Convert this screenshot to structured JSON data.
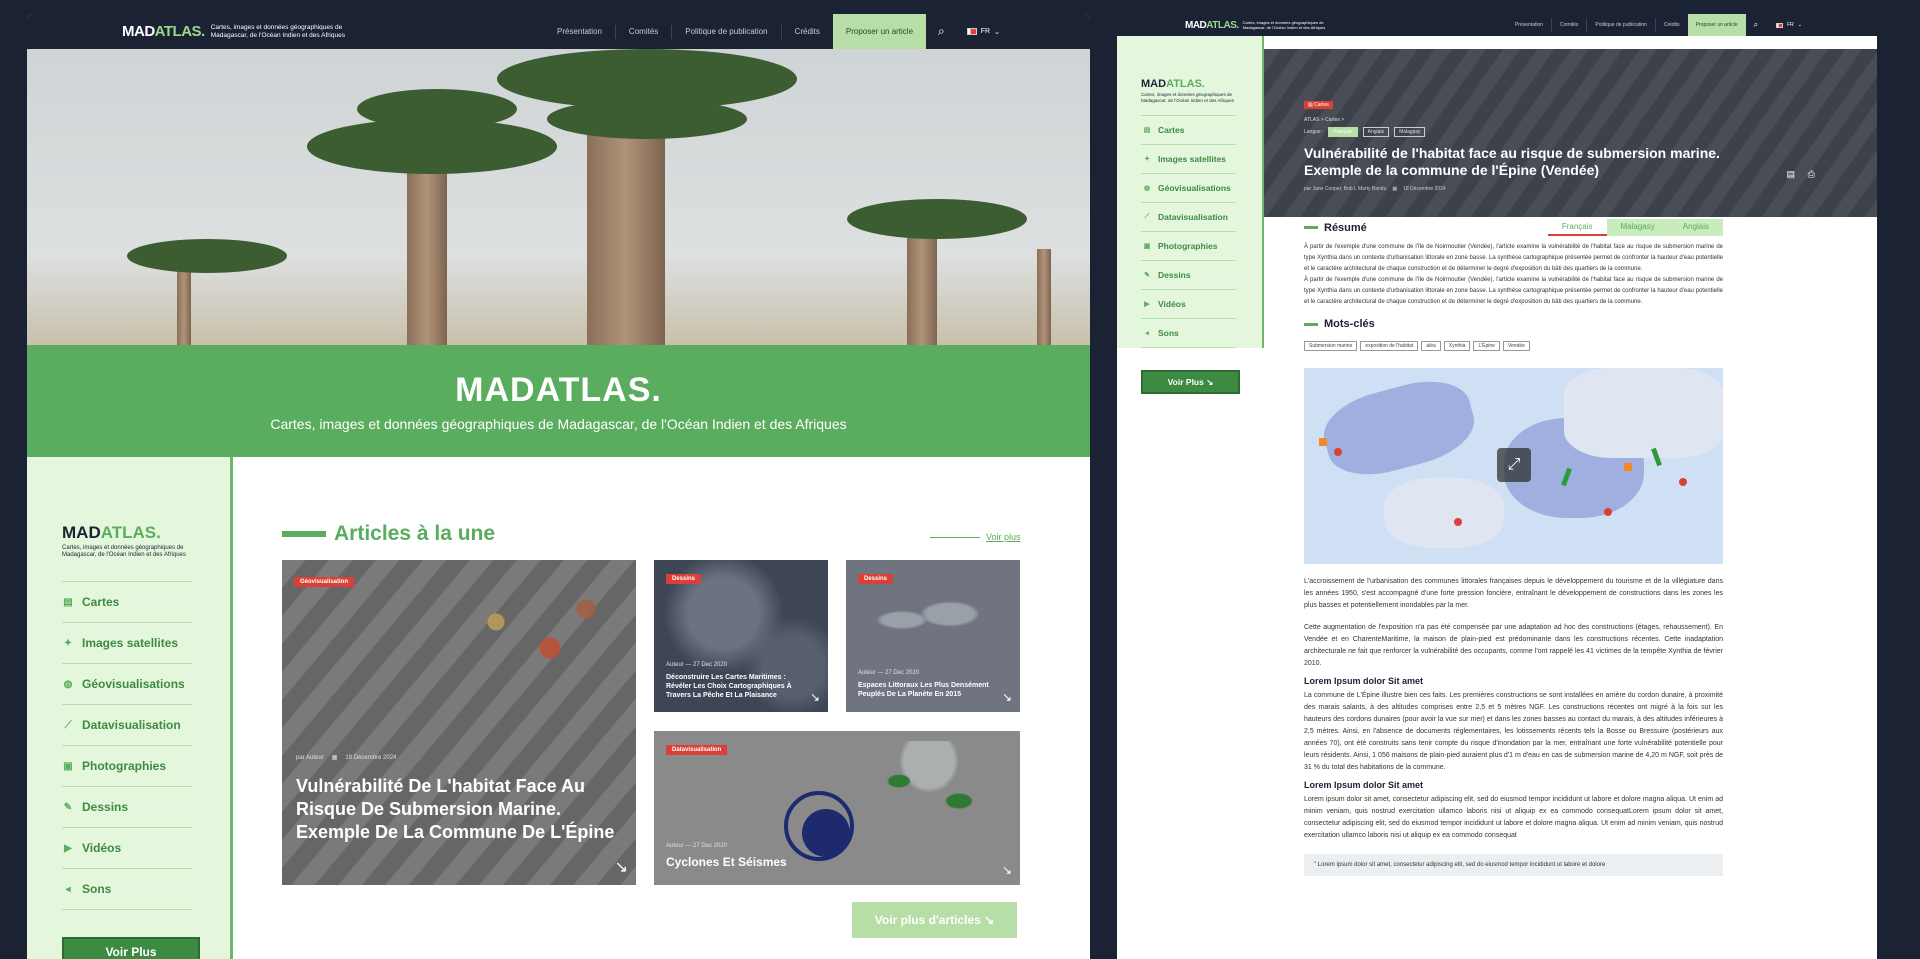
{
  "colors": {
    "brand": "#5aad5e",
    "nav": "#1a2233",
    "accent_red": "#d94038",
    "cta": "#b6dea6"
  },
  "brand": {
    "logo_a": "MAD",
    "logo_b": "ATLAS.",
    "tagline": "Cartes, images et données géographiques de Madagascar, de l'Océan Indien et des Afriques"
  },
  "nav": {
    "items": [
      "Présentation",
      "Comités",
      "Politique de publication",
      "Crédits"
    ],
    "cta": "Proposer un article",
    "search_icon": "search-icon",
    "lang": "FR"
  },
  "hero": {
    "title": "MADATLAS.",
    "subtitle": "Cartes, images et données géographiques de Madagascar, de l'Océan Indien et des Afriques"
  },
  "sidebar": {
    "items": [
      {
        "label": "Cartes",
        "icon": "map-icon"
      },
      {
        "label": "Images satellites",
        "icon": "satellite-icon"
      },
      {
        "label": "Géovisualisations",
        "icon": "globe-icon"
      },
      {
        "label": "Datavisualisation",
        "icon": "chart-icon"
      },
      {
        "label": "Photographies",
        "icon": "camera-icon"
      },
      {
        "label": "Dessins",
        "icon": "pencil-icon"
      },
      {
        "label": "Vidéos",
        "icon": "video-icon"
      },
      {
        "label": "Sons",
        "icon": "sound-icon"
      }
    ],
    "button": "Voir Plus"
  },
  "articles": {
    "title": "Articles à la une",
    "see_more": "Voir plus",
    "more_button": "Voir plus d'articles",
    "main": {
      "tag": "Géovisualisation",
      "author": "par Auteur",
      "date": "18 Décembre 2024",
      "title": "Vulnérabilité De L'habitat Face Au Risque De Submersion Marine. Exemple De La Commune De L'Épine"
    },
    "c1": {
      "tag": "Dessins",
      "meta": "Auteur — 27 Dec 2020",
      "title": "Déconstruire Les Cartes Maritimes : Révéler Les Choix Cartographiques À Travers La Pêche Et La Plaisance"
    },
    "c2": {
      "tag": "Dessins",
      "meta": "Auteur — 27 Dec 2020",
      "title": "Espaces Littoraux Les Plus Densément Peuplés De La Planète En 2015"
    },
    "c3": {
      "tag": "Datavisualisation",
      "meta": "Auteur — 27 Dec 2020",
      "title": "Cyclones Et Séismes"
    }
  },
  "detail": {
    "tag": "Cartes",
    "breadcrumb": "ATLAS > Cartes >",
    "lang_label": "Langue :",
    "langs": [
      "Français",
      "Anglais",
      "Malagasy"
    ],
    "title": "Vulnérabilité de l'habitat face au risque de submersion marine. Exemple de la commune de l'Épine (Vendée)",
    "byline": "par Jane Cooper, Bob L Marty Bandu",
    "date": "18 Décembre 2024",
    "resume_title": "Résumé",
    "tabs": [
      "Français",
      "Malagasy",
      "Anglais"
    ],
    "resume_p1": "À partir de l'exemple d'une commune de l'île de Noirmoutier (Vendée), l'article examine la vulnérabilité de l'habitat face au risque de submersion marine de type Xynthia dans un contexte d'urbanisation littorale en zone basse. La synthèse cartographique présentée permet de confronter la hauteur d'eau potentielle et le caractère architectural de chaque construction et de déterminer le degré d'exposition du bâti des quartiers de la commune.",
    "resume_p2": "À partir de l'exemple d'une commune de l'île de Noirmoutier (Vendée), l'article examine la vulnérabilité de l'habitat face au risque de submersion marine de type Xynthia dans un contexte d'urbanisation littorale en zone basse. La synthèse cartographique présentée permet de confronter la hauteur d'eau potentielle et le caractère architectural de chaque construction et de déterminer le degré d'exposition du bâti des quartiers de la commune.",
    "kw_title": "Mots-clés",
    "keywords": [
      "Submersion marine",
      "exposition de l'habitat",
      "aléa",
      "Xynthia",
      "L'Épine",
      "Vendée"
    ],
    "body1": "L'accroissement de l'urbanisation des communes littorales françaises depuis le développement du tourisme et de la villégiature dans les années 1950, s'est accompagné d'une forte pression foncière, entraînant le développement de constructions dans les zones les plus basses et potentiellement inondables par la mer.",
    "body2": "Cette augmentation de l'exposition n'a pas été compensée par une adaptation ad hoc des constructions (étages, rehaussement). En Vendée et en CharenteMaritime, la maison de plain-pied est prédominante dans les constructions récentes. Cette inadaptation architecturale ne fait que renforcer la vulnérabilité des occupants, comme l'ont rappelé les 41 victimes de la tempête Xynthia de février 2010.",
    "h1": "Lorem Ipsum dolor Sit amet",
    "body3": "La commune de L'Épine illustre bien ces faits. Les premières constructions se sont installées en arrière du cordon dunaire, à proximité des marais salants, à des altitudes comprises entre 2,5 et 5 mètres NGF. Les constructions récentes ont migré à la fois sur les hauteurs des cordons dunaires (pour avoir la vue sur mer) et dans les zones basses au contact du marais, à des altitudes inférieures à 2,5 mètres. Ainsi, en l'absence de documents réglementaires, les lotissements récents tels la Bosse ou Bressuire (postérieurs aux années 70), ont été construits sans tenir compte du risque d'inondation par la mer, entraînant une forte vulnérabilité potentielle pour leurs résidents. Ainsi, 1 056 maisons de plain-pied auraient plus d'1 m d'eau en cas de submersion marine de 4,20 m NGF, soit près de 31 % du total des habitations de la commune.",
    "h2": "Lorem Ipsum dolor Sit amet",
    "body4": "Lorem ipsum dolor sit amet, consectetur adipiscing elit, sed do eiusmod tempor incididunt ut labore et dolore magna aliqua. Ut enim ad minim veniam, quis nostrud exercitation ullamco laboris nisi ut aliquip ex ea commodo consequatLorem ipsum dolor sit amet, consectetur adipiscing elit, sed do eiusmod tempor incididunt ut labore et dolore magna aliqua. Ut enim ad minim veniam, quis nostrud exercitation ullamco laboris nisi ut aliquip ex ea commodo consequat",
    "quote": "\" Lorem ipsum dolor sit amet, consectetur adipiscing elit, sed do eiusmod tempor incididunt ut labore et dolore"
  }
}
